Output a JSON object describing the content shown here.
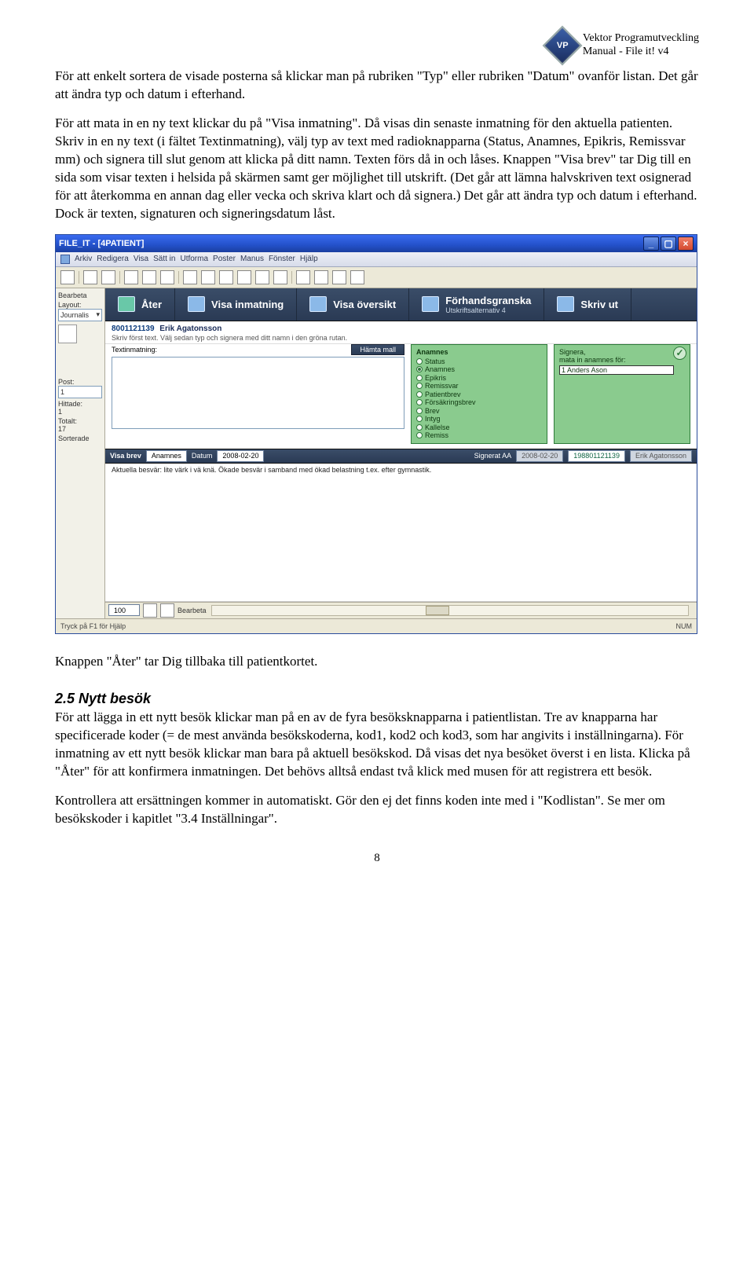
{
  "header": {
    "company": "Vektor Programutveckling",
    "manual": "Manual - File it! v4"
  },
  "para1": "För att enkelt sortera de visade posterna så klickar man på rubriken \"Typ\" eller rubriken \"Datum\" ovanför listan. Det går att ändra typ och datum i efterhand.",
  "para2": "För att mata in en ny text klickar du på \"Visa inmatning\". Då visas din senaste inmatning för den aktuella patienten. Skriv in en ny text (i fältet Textinmatning), välj typ av text med radioknapparna (Status, Anamnes, Epikris, Remissvar mm) och signera till slut genom att klicka på ditt namn. Texten förs då in och låses. Knappen \"Visa brev\" tar Dig till en sida som visar texten i helsida på skärmen samt ger möjlighet till utskrift. (Det går att lämna halvskriven text osignerad för att återkomma en annan dag eller vecka och skriva klart och då signera.) Det går att ändra typ och datum i efterhand. Dock är texten, signaturen och signeringsdatum låst.",
  "screenshot": {
    "title": "FILE_IT - [4PATIENT]",
    "menu": {
      "icon": "Arkiv",
      "items": [
        "Arkiv",
        "Redigera",
        "Visa",
        "Sätt in",
        "Utforma",
        "Poster",
        "Manus",
        "Fönster",
        "Hjälp"
      ]
    },
    "sidebar": {
      "bearbeta": "Bearbeta",
      "layout": "Layout:",
      "layout_val": "Journalis",
      "post": "Post:",
      "post_val": "1",
      "hittade": "Hittade:",
      "hittade_val": "1",
      "totalt": "Totalt:",
      "totalt_val": "17",
      "sorterade": "Sorterade"
    },
    "bigbar": {
      "ater": "Åter",
      "inmatning": "Visa inmatning",
      "oversikt": "Visa översikt",
      "forhand": "Förhandsgranska",
      "forhand_sub": "Utskriftsalternativ 4",
      "skrivut": "Skriv ut"
    },
    "patient": {
      "id": "8001121139",
      "name": "Erik Agatonsson",
      "hint": "Skriv först text. Välj sedan typ och signera med ditt namn i den gröna rutan."
    },
    "entry": {
      "label": "Textinmatning:",
      "mall": "Hämta mall"
    },
    "anamnes": {
      "title": "Anamnes",
      "opts": [
        "Status",
        "Anamnes",
        "Epikris",
        "Remissvar",
        "Patientbrev",
        "Försäkringsbrev",
        "Brev",
        "Intyg",
        "Kallelse",
        "Remiss"
      ],
      "selected": "Anamnes"
    },
    "signera": {
      "title": "Signera,",
      "line2": "mata in anamnes för:",
      "value": "1   Anders Ason"
    },
    "rec": {
      "visabrev": "Visa brev",
      "typ": "Anamnes",
      "datum_lbl": "Datum",
      "datum": "2008-02-20",
      "signerat": "Signerat AA",
      "sigdate": "2008-02-20",
      "ref": "198801121139",
      "refname": "Erik Agatonsson"
    },
    "rec_text": "Aktuella besvär: lite värk i vä knä. Ökade besvär i samband med ökad belastning t.ex. efter gymnastik.",
    "footer": {
      "zoom": "100",
      "layoutbtn": "Bearbeta"
    },
    "status": {
      "hint": "Tryck på F1 för Hjälp",
      "num": "NUM"
    }
  },
  "para3": "Knappen \"Åter\" tar Dig tillbaka till patientkortet.",
  "section": "2.5 Nytt besök",
  "para4": "För att lägga in ett nytt besök klickar man på en av de fyra besöksknapparna i patientlistan. Tre av knapparna har specificerade koder (= de mest använda besökskoderna, kod1, kod2 och kod3, som har angivits i inställningarna). För inmatning av ett nytt besök klickar man bara på aktuell besökskod. Då visas det nya besöket överst i en lista. Klicka på \"Åter\" för att konfirmera inmatningen. Det behövs alltså endast två klick med musen för att registrera ett besök.",
  "para5": "Kontrollera att ersättningen kommer in automatiskt. Gör den ej det finns koden inte med i \"Kodlistan\". Se mer om besökskoder i kapitlet \"3.4 Inställningar\".",
  "page_num": "8"
}
